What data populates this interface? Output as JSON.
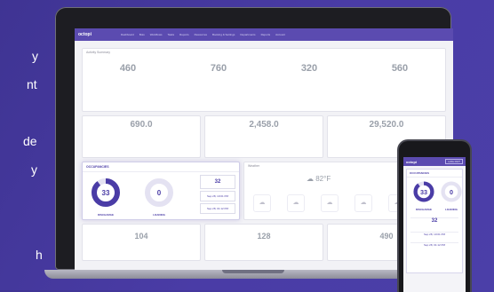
{
  "side_text": [
    "y",
    "nt",
    "de",
    "y",
    "h"
  ],
  "nav": {
    "logo": "octopi",
    "items": [
      "Dashboard",
      "Bots",
      "Workflows",
      "Tasks",
      "Reports",
      "Resources",
      "Booking & Settings",
      "Departments",
      "Reports",
      "Account"
    ]
  },
  "counts": {
    "title": "Activity Summary",
    "values": [
      "460",
      "760",
      "320",
      "560"
    ]
  },
  "metrics": {
    "values": [
      "690.0",
      "2,458.0",
      "29,520.0"
    ]
  },
  "occupancy": {
    "title": "OCCUPANCIES",
    "discharged": {
      "value": "33",
      "label": "DISCHARGE"
    },
    "loading": {
      "value": "0",
      "label": "LOADING"
    },
    "stat": "32",
    "dates": [
      "Sep 28, 10:01 PM",
      "Sep 28, 01:12 PM"
    ]
  },
  "weather": {
    "title": "Weather",
    "temp": "82°F"
  },
  "bottom": {
    "values": [
      "104",
      "128",
      "490"
    ]
  },
  "phone": {
    "logo": "octopi",
    "cta": "LOG OUT",
    "title": "OCCUPANCIES",
    "discharged": "33",
    "loading": "0",
    "discharged_label": "DISCHARGE",
    "loading_label": "LOADING",
    "stat": "32",
    "dates": [
      "Sep 28, 10:01 PM",
      "Sep 28, 01:12 PM"
    ]
  },
  "colors": {
    "background": "#4a3ca6",
    "accent": "#4a3ca6",
    "navbar": "#5b4bb0"
  }
}
